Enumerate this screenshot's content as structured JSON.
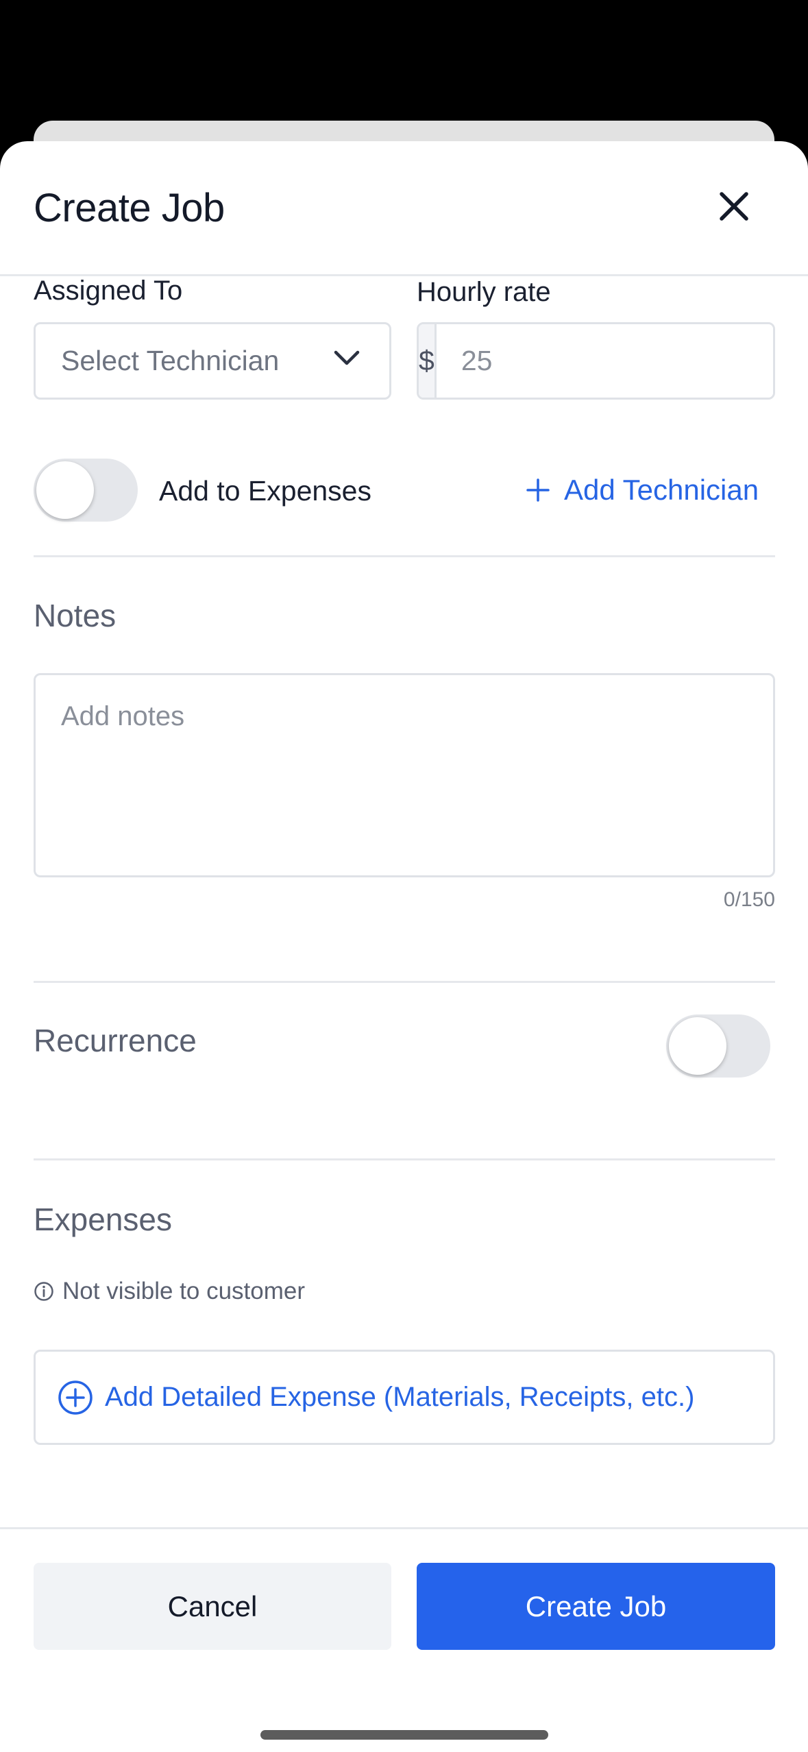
{
  "header": {
    "title": "Create Job",
    "close_icon": "close-icon"
  },
  "assigned": {
    "label": "Assigned To",
    "select_placeholder": "Select Technician"
  },
  "rate": {
    "label": "Hourly rate",
    "currency": "$",
    "placeholder": "25"
  },
  "expenses_toggle": {
    "label": "Add to Expenses",
    "on": false
  },
  "add_technician": {
    "label": "Add Technician"
  },
  "notes": {
    "title": "Notes",
    "placeholder": "Add notes",
    "counter": "0/150"
  },
  "recurrence": {
    "title": "Recurrence",
    "on": false
  },
  "expenses": {
    "title": "Expenses",
    "info": "Not visible to customer",
    "add_label": "Add Detailed Expense (Materials, Receipts, etc.)"
  },
  "footer": {
    "cancel_label": "Cancel",
    "create_label": "Create Job"
  },
  "colors": {
    "accent": "#2563eb",
    "link": "#2664e4",
    "text": "#141a29",
    "muted": "#5a6070",
    "border": "#dfe2e7"
  }
}
